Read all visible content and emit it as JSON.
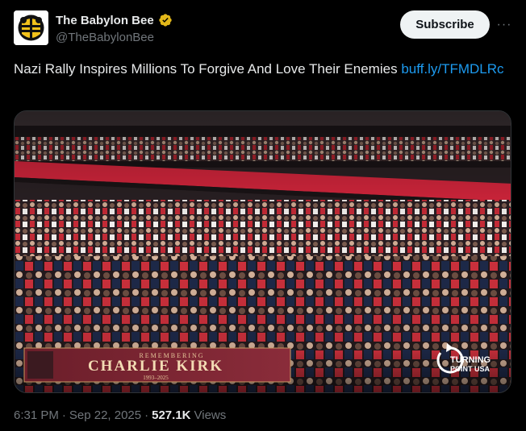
{
  "account": {
    "display_name": "The Babylon Bee",
    "handle": "@TheBabylonBee",
    "verified": true,
    "verified_color": "#e2b719"
  },
  "actions": {
    "subscribe_label": "Subscribe",
    "more_label": "···"
  },
  "tweet": {
    "text": "Nazi Rally Inspires Millions To Forgive And Love Their Enemies ",
    "link_text": "buff.ly/TFMDLRc"
  },
  "media": {
    "banner_label": "REMEMBERING",
    "banner_name": "CHARLIE KIRK",
    "banner_years": "1993–2025",
    "logo_line1": "TURNING",
    "logo_line2": "POINT USA",
    "ribbon_color": "#d7263d"
  },
  "footer": {
    "time": "6:31 PM",
    "separator": "·",
    "date": "Sep 22, 2025",
    "separator2": "·",
    "views_count": "527.1K",
    "views_label": "Views"
  }
}
